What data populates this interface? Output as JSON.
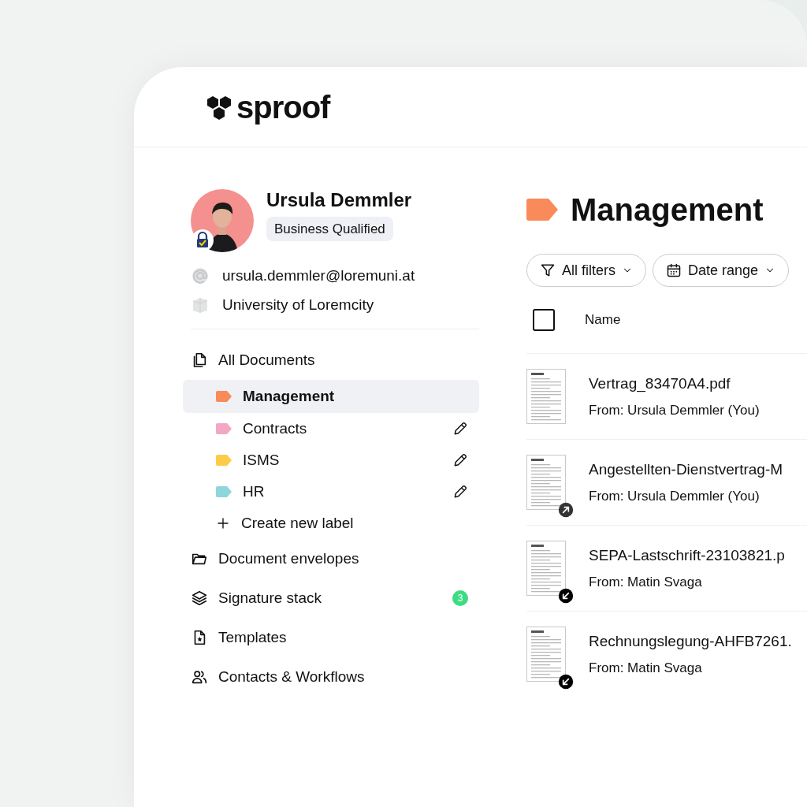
{
  "logo": {
    "text": "sproof"
  },
  "profile": {
    "name": "Ursula Demmler",
    "badge": "Business Qualified",
    "verified": true,
    "email": "ursula.demmler@loremuni.at",
    "organization": "University of Loremcity"
  },
  "sidebar": {
    "items": [
      {
        "kind": "section",
        "label": "All Documents",
        "selected": false
      },
      {
        "kind": "label",
        "label": "Management",
        "color": "#f98a5a",
        "selected": true,
        "editable": false
      },
      {
        "kind": "label",
        "label": "Contracts",
        "color": "#f3a7c4",
        "selected": false,
        "editable": true
      },
      {
        "kind": "label",
        "label": "ISMS",
        "color": "#fdcc48",
        "selected": false,
        "editable": true
      },
      {
        "kind": "label",
        "label": "HR",
        "color": "#8fd5dc",
        "selected": false,
        "editable": true
      },
      {
        "kind": "create",
        "label": "Create new label",
        "selected": false
      },
      {
        "kind": "section",
        "label": "Document envelopes",
        "selected": false
      },
      {
        "kind": "section",
        "label": "Signature stack",
        "count": "3",
        "selected": false
      },
      {
        "kind": "section",
        "label": "Templates",
        "selected": false
      },
      {
        "kind": "section",
        "label": "Contacts & Workflows",
        "selected": false
      }
    ]
  },
  "main": {
    "title": "Management",
    "filters": [
      {
        "label": "All filters"
      },
      {
        "label": "Date range"
      }
    ],
    "table": {
      "select_all_checked": false,
      "columns": [
        "Name"
      ],
      "rows": [
        {
          "kind": "plain",
          "name": "Vertrag_83470A4.pdf",
          "from": "From: Ursula Demmler (You)"
        },
        {
          "kind": "outgoing",
          "name": "Angestellten-Dienstvertrag-M",
          "from": "From: Ursula Demmler (You)"
        },
        {
          "kind": "incoming",
          "name": "SEPA-Lastschrift-23103821.p",
          "from": "From: Matin Svaga"
        },
        {
          "kind": "incoming",
          "name": "Rechnungslegung-AHFB7261.",
          "from": "From: Matin Svaga"
        }
      ]
    }
  }
}
